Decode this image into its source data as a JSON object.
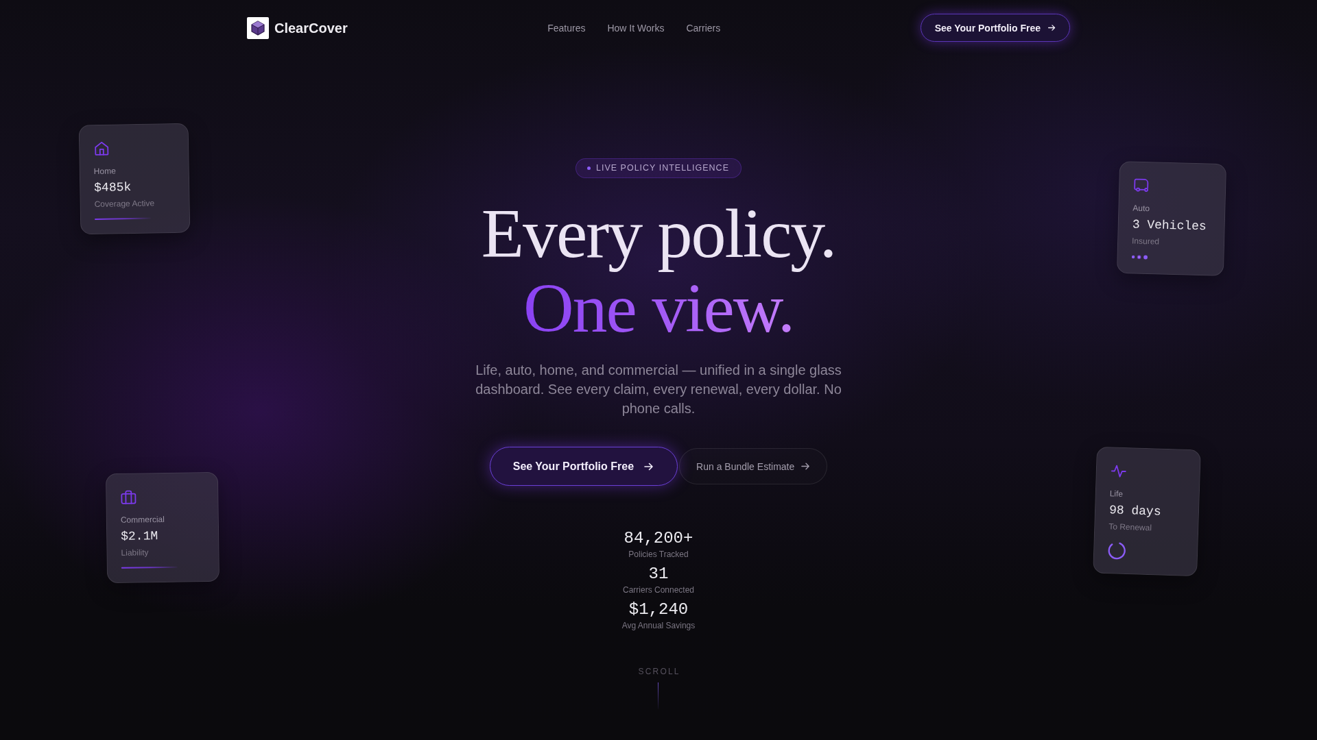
{
  "nav": {
    "brand": "ClearCover",
    "links": [
      "Features",
      "How It Works",
      "Carriers"
    ],
    "cta": "See Your Portfolio Free"
  },
  "hero": {
    "badge": "LIVE POLICY INTELLIGENCE",
    "headline": {
      "line_1": "Every policy.",
      "line_2": "One view."
    },
    "subtitle": "Life, auto, home, and commercial — unified in a single glass dashboard. See every claim, every renewal, every dollar. No phone calls.",
    "buttons": [
      {
        "kind": "primary",
        "label": "See Your Portfolio Free"
      },
      {
        "kind": "secondary",
        "label": "Run a Bundle Estimate"
      }
    ],
    "stats": [
      {
        "value": "84,200+",
        "label": "Policies Tracked"
      },
      {
        "value": "31",
        "label": "Carriers Connected"
      },
      {
        "value": "$1,240",
        "label": "Avg Annual Savings"
      }
    ],
    "scroll_hint": "SCROLL"
  },
  "floating_cards": [
    {
      "kind": "home",
      "label": "Home",
      "value": "$485k",
      "caption": "Coverage Active"
    },
    {
      "kind": "auto",
      "label": "Auto",
      "value": "3 Vehicles",
      "caption": "Insured"
    },
    {
      "kind": "commercial",
      "label": "Commercial",
      "value": "$2.1M",
      "caption": "Liability"
    },
    {
      "kind": "life",
      "label": "Life",
      "value": "98 days",
      "caption": "To Renewal"
    }
  ]
}
